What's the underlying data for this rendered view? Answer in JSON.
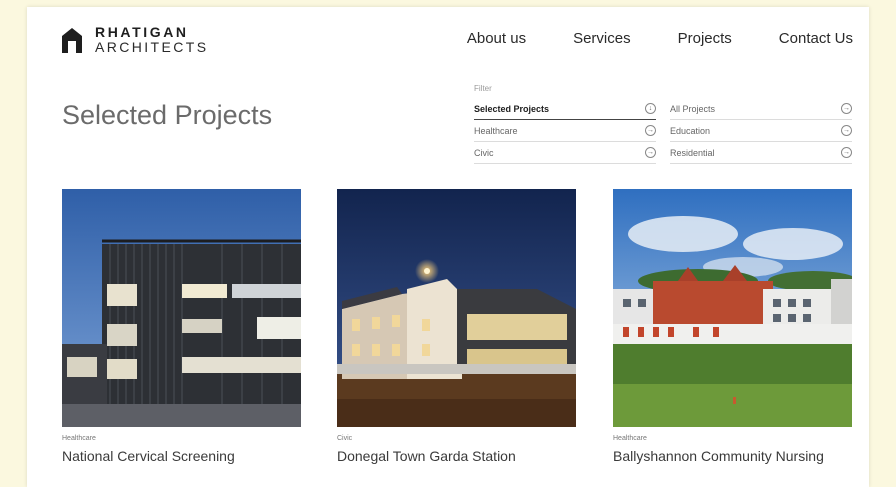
{
  "brand": {
    "line1": "RHATIGAN",
    "line2": "ARCHITECTS"
  },
  "nav": {
    "items": [
      "About us",
      "Services",
      "Projects",
      "Contact Us"
    ]
  },
  "page": {
    "title": "Selected Projects"
  },
  "filter": {
    "label": "Filter",
    "items": [
      {
        "label": "Selected Projects",
        "icon": "download-circle-icon",
        "active": true
      },
      {
        "label": "All Projects",
        "icon": "arrow-right-circle-icon"
      },
      {
        "label": "Healthcare",
        "icon": "arrow-right-circle-icon"
      },
      {
        "label": "Education",
        "icon": "arrow-right-circle-icon"
      },
      {
        "label": "Civic",
        "icon": "arrow-right-circle-icon"
      },
      {
        "label": "Residential",
        "icon": "arrow-right-circle-icon"
      }
    ]
  },
  "projects": [
    {
      "category": "Healthcare",
      "title": "National Cervical Screening"
    },
    {
      "category": "Civic",
      "title": "Donegal Town Garda Station"
    },
    {
      "category": "Healthcare",
      "title": "Ballyshannon Community Nursing"
    }
  ]
}
